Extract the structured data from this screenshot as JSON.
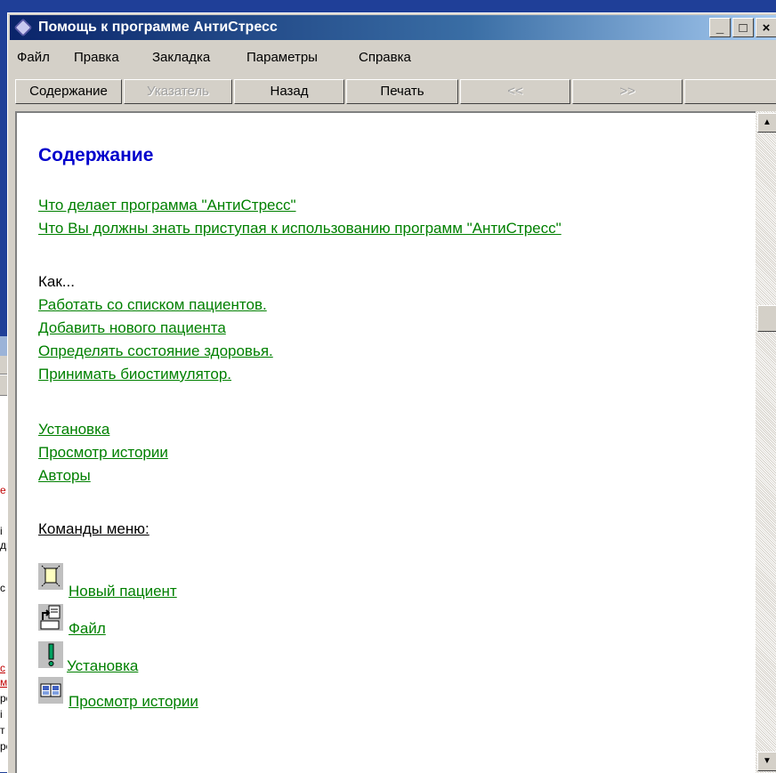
{
  "window": {
    "title": "Помощь к программе АнтиСтресс",
    "minimize": "_",
    "maximize": "□",
    "close": "×"
  },
  "menu": {
    "items": [
      "Файл",
      "Правка",
      "Закладка",
      "Параметры",
      "Справка"
    ]
  },
  "toolbar": {
    "buttons": [
      {
        "label": "Содержание",
        "disabled": false
      },
      {
        "label": "Указатель",
        "disabled": true
      },
      {
        "label": "Назад",
        "disabled": false
      },
      {
        "label": "Печать",
        "disabled": false
      },
      {
        "label": "<<",
        "disabled": true
      },
      {
        "label": ">>",
        "disabled": true
      }
    ]
  },
  "content": {
    "heading": "Содержание",
    "intro_links": [
      "Что делает программа \"АнтиСтресс\"",
      "Что Вы  должны знать приступая к использованию программ \"АнтиСтресс\""
    ],
    "how_label": "Как...",
    "how_links": [
      "Работать со списком пациентов.",
      "Добавить нового пациента",
      "Определять состояние здоровья.",
      "Принимать биостимулятор."
    ],
    "more_links": [
      "Установка",
      "Просмотр истории",
      "Авторы"
    ],
    "menu_commands_label": "Команды меню:",
    "commands": [
      {
        "label": "Новый пациент",
        "icon": "new-patient-icon"
      },
      {
        "label": "Файл",
        "icon": "file-icon"
      },
      {
        "label": "Установка",
        "icon": "settings-icon"
      },
      {
        "label": "Просмотр истории",
        "icon": "history-icon"
      }
    ]
  },
  "scrollbar": {
    "up": "▲",
    "down": "▼"
  },
  "background_window": {
    "fragments": [
      "е",
      "і",
      "ди",
      "с",
      "с",
      "ме",
      "ро",
      "і",
      "т",
      "ро"
    ]
  }
}
